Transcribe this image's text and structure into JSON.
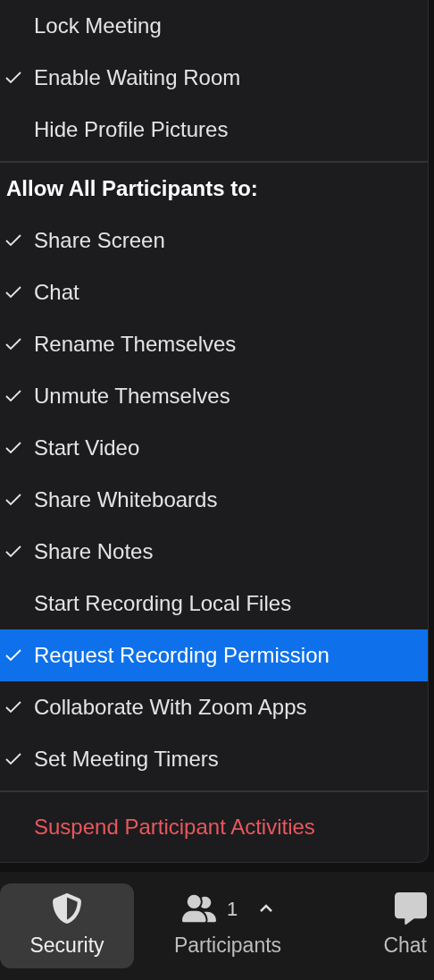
{
  "menu": {
    "top_items": [
      {
        "label": "Lock Meeting",
        "checked": false
      },
      {
        "label": "Enable Waiting Room",
        "checked": true
      },
      {
        "label": "Hide Profile Pictures",
        "checked": false
      }
    ],
    "section_header": "Allow All Participants to:",
    "permissions": [
      {
        "label": "Share Screen",
        "checked": true,
        "selected": false
      },
      {
        "label": "Chat",
        "checked": true,
        "selected": false
      },
      {
        "label": "Rename Themselves",
        "checked": true,
        "selected": false
      },
      {
        "label": "Unmute Themselves",
        "checked": true,
        "selected": false
      },
      {
        "label": "Start Video",
        "checked": true,
        "selected": false
      },
      {
        "label": "Share Whiteboards",
        "checked": true,
        "selected": false
      },
      {
        "label": "Share Notes",
        "checked": true,
        "selected": false
      },
      {
        "label": "Start Recording Local Files",
        "checked": false,
        "selected": false
      },
      {
        "label": "Request Recording Permission",
        "checked": true,
        "selected": true
      },
      {
        "label": "Collaborate With Zoom Apps",
        "checked": true,
        "selected": false
      },
      {
        "label": "Set Meeting Timers",
        "checked": true,
        "selected": false
      }
    ],
    "danger_item": "Suspend Participant Activities"
  },
  "toolbar": {
    "buttons": [
      {
        "kind": "security",
        "label": "Security",
        "selected": true
      },
      {
        "kind": "participants",
        "label": "Participants",
        "count": "1",
        "selected": false
      },
      {
        "kind": "chat",
        "label": "Chat",
        "selected": false
      }
    ]
  }
}
